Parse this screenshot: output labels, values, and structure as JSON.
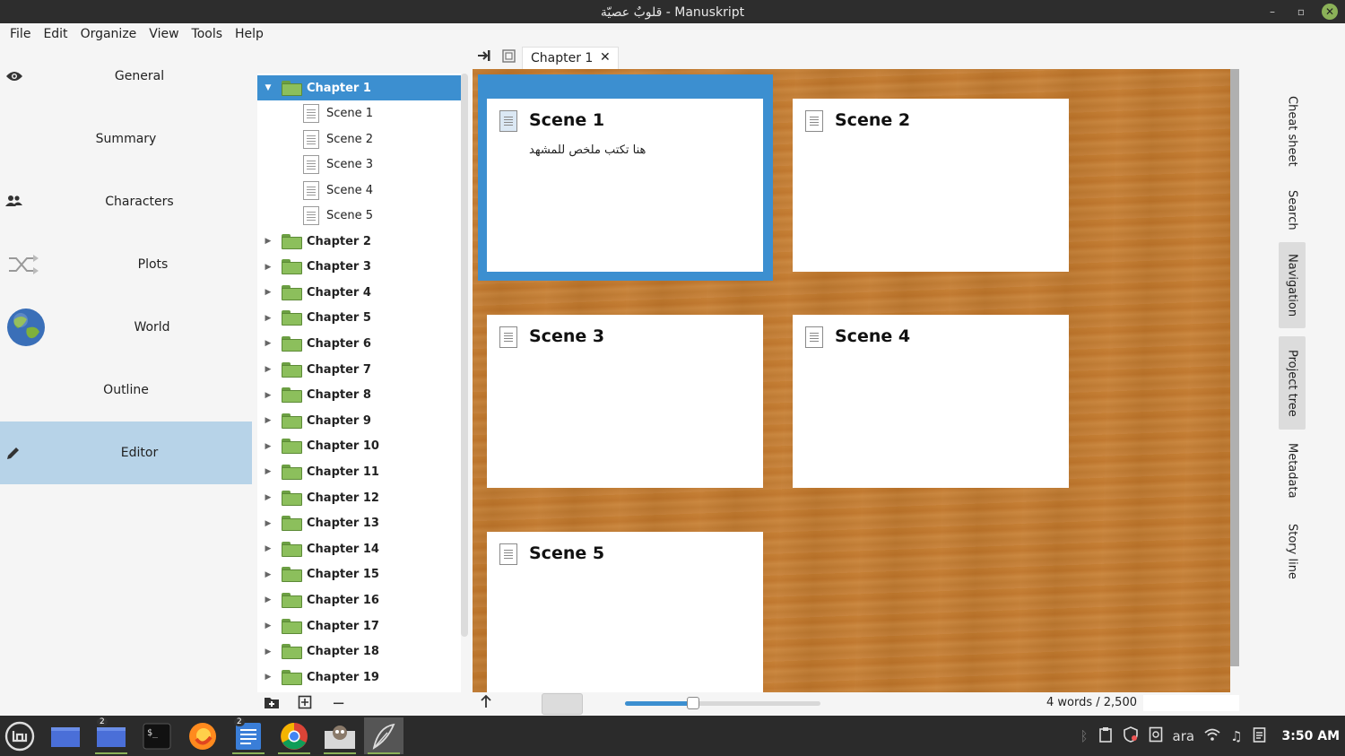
{
  "window": {
    "title": "قلوبٌ عصيّة - Manuskript"
  },
  "menu": [
    "File",
    "Edit",
    "Organize",
    "View",
    "Tools",
    "Help"
  ],
  "leftnav": [
    {
      "label": "General",
      "icon": "eye-icon"
    },
    {
      "label": "Summary",
      "icon": ""
    },
    {
      "label": "Characters",
      "icon": "people-icon"
    },
    {
      "label": "Plots",
      "icon": "shuffle-icon"
    },
    {
      "label": "World",
      "icon": "globe-icon"
    },
    {
      "label": "Outline",
      "icon": ""
    },
    {
      "label": "Editor",
      "icon": "pencil-icon",
      "active": true
    }
  ],
  "tree": {
    "chapter1": "Chapter 1",
    "scenes": [
      "Scene 1",
      "Scene 2",
      "Scene 3",
      "Scene 4",
      "Scene 5"
    ],
    "chapters": [
      "Chapter 2",
      "Chapter 3",
      "Chapter 4",
      "Chapter 5",
      "Chapter 6",
      "Chapter 7",
      "Chapter 8",
      "Chapter 9",
      "Chapter 10",
      "Chapter 11",
      "Chapter 12",
      "Chapter 13",
      "Chapter 14",
      "Chapter 15",
      "Chapter 16",
      "Chapter 17",
      "Chapter 18",
      "Chapter 19"
    ],
    "buttons": {
      "add_folder": "+",
      "add_item": "⊞",
      "remove": "−"
    }
  },
  "tabs": {
    "active": "Chapter 1",
    "close": "✕"
  },
  "cards": [
    {
      "title": "Scene 1",
      "summary": "هنا تكتب ملخص للمشهد"
    },
    {
      "title": "Scene 2",
      "summary": ""
    },
    {
      "title": "Scene 3",
      "summary": ""
    },
    {
      "title": "Scene 4",
      "summary": ""
    },
    {
      "title": "Scene 5",
      "summary": ""
    }
  ],
  "status": {
    "words": "4  words / 2,500",
    "zoom_fraction": 0.35
  },
  "rightdock": [
    {
      "label": "Cheat sheet"
    },
    {
      "label": "Search"
    },
    {
      "label": "Navigation",
      "active": true
    },
    {
      "label": "Project tree",
      "active": true
    },
    {
      "label": "Metadata"
    },
    {
      "label": "Story line"
    }
  ],
  "taskbar": {
    "apps": [
      "mint-menu-icon",
      "files-icon",
      "files-icon",
      "terminal-icon",
      "firefox-icon",
      "text-editor-icon",
      "chrome-icon",
      "gimp-icon",
      "manuskript-icon"
    ],
    "badges": {
      "files2": "2",
      "editor": "2"
    },
    "lang": "ara",
    "clock": "3:50 AM"
  },
  "colors": {
    "accent": "#3c8fd0",
    "nav_active": "#b7d3e8",
    "folder": "#8cbf5c",
    "cork": "#c47c30"
  }
}
